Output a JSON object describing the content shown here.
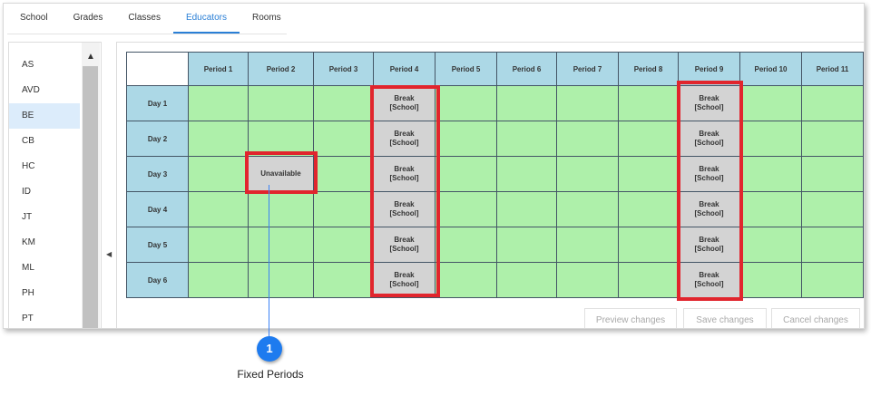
{
  "tabs": [
    {
      "label": "School",
      "active": false
    },
    {
      "label": "Grades",
      "active": false
    },
    {
      "label": "Classes",
      "active": false
    },
    {
      "label": "Educators",
      "active": true
    },
    {
      "label": "Rooms",
      "active": false
    }
  ],
  "educators": {
    "items": [
      "AS",
      "AVD",
      "BE",
      "CB",
      "HC",
      "ID",
      "JT",
      "KM",
      "ML",
      "PH",
      "PT"
    ],
    "selected": "BE"
  },
  "timetable": {
    "periods": [
      "Period 1",
      "Period 2",
      "Period 3",
      "Period 4",
      "Period 5",
      "Period 6",
      "Period 7",
      "Period 8",
      "Period 9",
      "Period 10",
      "Period 11"
    ],
    "days": [
      "Day 1",
      "Day 2",
      "Day 3",
      "Day 4",
      "Day 5",
      "Day 6"
    ],
    "fixed_cells": [
      {
        "day": "Day 1",
        "period": "Period 4",
        "text": "Break\n[School]"
      },
      {
        "day": "Day 2",
        "period": "Period 4",
        "text": "Break\n[School]"
      },
      {
        "day": "Day 3",
        "period": "Period 4",
        "text": "Break\n[School]"
      },
      {
        "day": "Day 4",
        "period": "Period 4",
        "text": "Break\n[School]"
      },
      {
        "day": "Day 5",
        "period": "Period 4",
        "text": "Break\n[School]"
      },
      {
        "day": "Day 6",
        "period": "Period 4",
        "text": "Break\n[School]"
      },
      {
        "day": "Day 1",
        "period": "Period 9",
        "text": "Break\n[School]"
      },
      {
        "day": "Day 2",
        "period": "Period 9",
        "text": "Break\n[School]"
      },
      {
        "day": "Day 3",
        "period": "Period 9",
        "text": "Break\n[School]"
      },
      {
        "day": "Day 4",
        "period": "Period 9",
        "text": "Break\n[School]"
      },
      {
        "day": "Day 5",
        "period": "Period 9",
        "text": "Break\n[School]"
      },
      {
        "day": "Day 6",
        "period": "Period 9",
        "text": "Break\n[School]"
      },
      {
        "day": "Day 3",
        "period": "Period 2",
        "text": "Unavailable"
      }
    ]
  },
  "actions": {
    "preview_label": "Preview changes",
    "save_label": "Save changes",
    "cancel_label": "Cancel changes"
  },
  "callout": {
    "number": "1",
    "label": "Fixed Periods"
  },
  "colors": {
    "header_bg": "#acd8e6",
    "free_slot": "#aef0aa",
    "fixed_slot": "#d3d3d3",
    "highlight": "#e1252d",
    "active_tab": "#2a7fd6",
    "callout": "#1e7bef"
  }
}
